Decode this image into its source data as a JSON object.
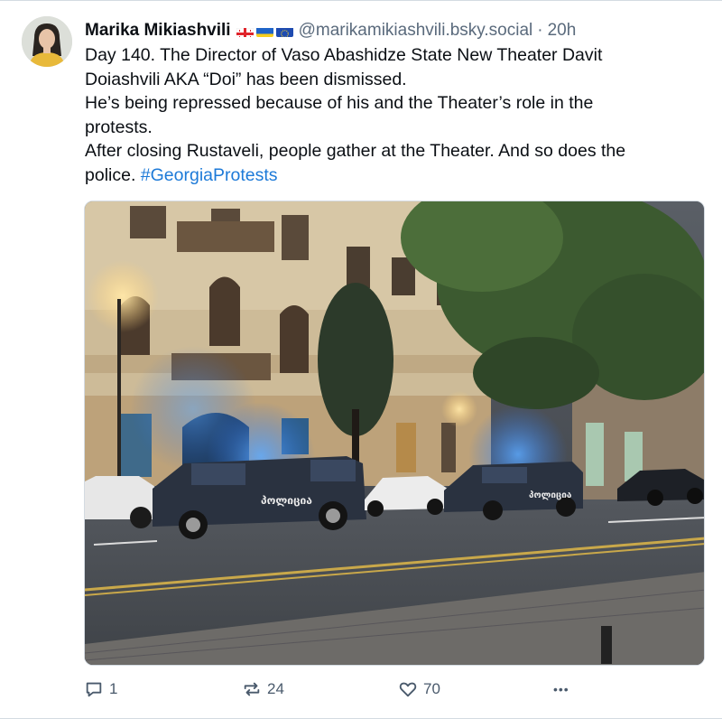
{
  "post": {
    "author_name": "Marika Mikiashvili",
    "author_flags": [
      "georgia-flag",
      "ukraine-flag",
      "eu-flag"
    ],
    "handle": "@marikamikiashvili.bsky.social",
    "separator": "·",
    "time": "20h",
    "text_lines": [
      "Day 140. The Director of Vaso Abashidze State New Theater Davit",
      "Doiashvili AKA “Doi” has been dismissed.",
      "He’s being repressed because of his and the Theater’s role in the",
      "protests.",
      "After closing Rustaveli, people gather at the Theater. And so does the"
    ],
    "last_line_text": "police.",
    "hashtag": "#GeorgiaProtests",
    "image": {
      "van_text_1": "პოლიცია",
      "van_text_2": "პოლიცია"
    }
  },
  "actions": {
    "reply_count": "1",
    "repost_count": "24",
    "like_count": "70",
    "more_label": "•••"
  },
  "colors": {
    "link": "#1d7ad8",
    "muted": "#5a6a7c",
    "icon": "#4a5a6c"
  }
}
